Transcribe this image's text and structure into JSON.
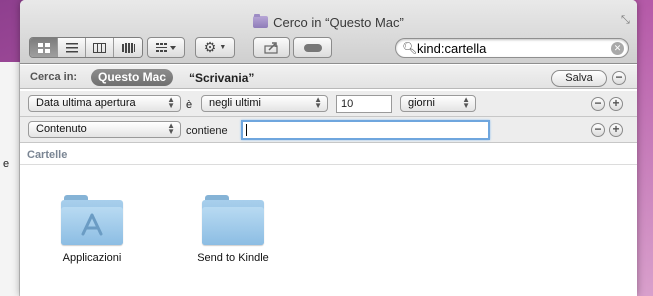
{
  "background": {
    "left_sidebar_letter": "e"
  },
  "window": {
    "title": "Cerco in “Questo Mac”",
    "toolbar": {
      "view_buttons": [
        "icon-view",
        "list-view",
        "column-view",
        "coverflow-view"
      ],
      "arrange_icon": "arrange-icon",
      "action_icon": "gear-icon",
      "share_icon": "share-icon",
      "toggle_icon": "toggle-icon"
    },
    "search": {
      "value": "kind:cartella",
      "placeholder": ""
    }
  },
  "scope": {
    "label": "Cerca in:",
    "selected": "Questo Mac",
    "other": "“Scrivania”",
    "save_label": "Salva",
    "remove_symbol": "−"
  },
  "rules": [
    {
      "attribute": "Data ultima apertura",
      "operator_prefix": "è",
      "operator": "negli ultimi",
      "value": "10",
      "unit": "giorni"
    },
    {
      "attribute": "Contenuto",
      "operator_prefix": "contiene",
      "value": ""
    }
  ],
  "rule_buttons": {
    "remove": "−",
    "add": "+"
  },
  "results": {
    "section_title": "Cartelle",
    "items": [
      {
        "label": "Applicazioni",
        "icon": "applications-folder-icon"
      },
      {
        "label": "Send to Kindle",
        "icon": "folder-icon"
      }
    ]
  },
  "colors": {
    "accent_focus": "#6fa6de",
    "folder_blue": "#8cbde3",
    "desktop_purple": "#b55aa8"
  }
}
